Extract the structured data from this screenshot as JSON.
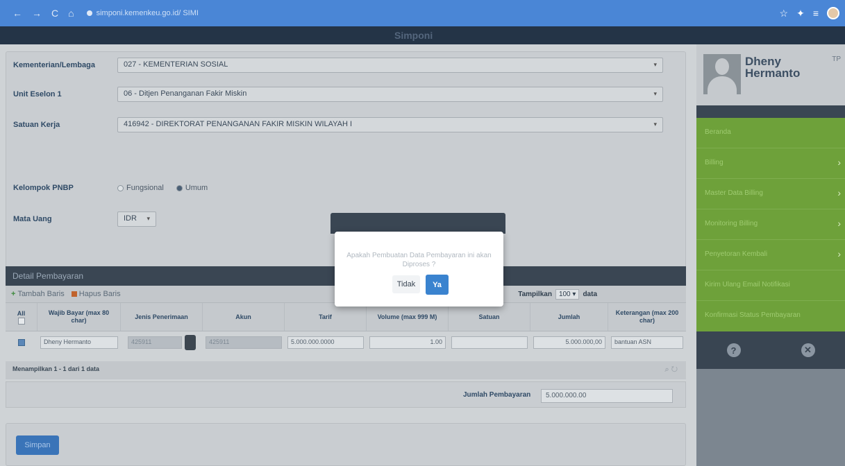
{
  "browser": {
    "url": "simponi.kemenkeu.go.id/ SIMI",
    "nav_back": "←",
    "nav_forward": "→",
    "nav_reload": "C",
    "nav_home": "⌂"
  },
  "app": {
    "logo": "Simponi"
  },
  "form": {
    "kementerian_label": "Kementerian/Lembaga",
    "kementerian_value": "027 - KEMENTERIAN SOSIAL",
    "eselon_label": "Unit Eselon 1",
    "eselon_value": "06 - Ditjen Penanganan Fakir Miskin",
    "satker_label": "Satuan Kerja",
    "satker_value": "416942 - DIREKTORAT PENANGANAN FAKIR MISKIN WILAYAH I",
    "pnbp_label": "Kelompok PNBP",
    "pnbp_options": [
      "Fungsional",
      "Umum"
    ],
    "mata_uang_label": "Mata Uang",
    "mata_uang_value": "IDR"
  },
  "detail": {
    "title": "Detail Pembayaran",
    "add_label": "Tambah Baris",
    "delete_label": "Hapus Baris",
    "show_label": "Tampilkan",
    "show_value": "100",
    "show_suffix": "data",
    "columns": [
      "All",
      "Wajib Bayar (max 80 char)",
      "Jenis Penerimaan",
      "Akun",
      "Tarif",
      "Volume (max 999 M)",
      "Satuan",
      "Jumlah",
      "Keterangan (max 200 char)"
    ],
    "row": {
      "wajib_bayar": "Dheny Hermanto",
      "jenis": "425911",
      "akun": "425911",
      "tarif": "5.000.000.0000",
      "volume": "1.00",
      "satuan": "",
      "jumlah": "5.000.000,00",
      "keterangan": "bantuan ASN"
    },
    "pager_text": "Menampilkan 1 - 1 dari 1 data",
    "total_label": "Jumlah Pembayaran",
    "total_value": "5.000.000.00"
  },
  "save_label": "Simpan",
  "sidebar": {
    "user_name": "Dheny Hermanto",
    "tp": "TP",
    "menu": [
      {
        "label": "Beranda",
        "has_chevron": false
      },
      {
        "label": "Billing",
        "has_chevron": true
      },
      {
        "label": "Master Data Billing",
        "has_chevron": true
      },
      {
        "label": "Monitoring Billing",
        "has_chevron": true
      },
      {
        "label": "Penyetoran Kembali",
        "has_chevron": true
      },
      {
        "label": "Kirim Ulang Email Notifikasi",
        "has_chevron": false
      },
      {
        "label": "Konfirmasi Status Pembayaran",
        "has_chevron": false
      }
    ],
    "help_icon": "?",
    "close_icon": "✕"
  },
  "modal": {
    "message": "Apakah Pembuatan Data Pembayaran ini akan Diproses ?",
    "cancel_label": "Tidak",
    "confirm_label": "Ya"
  }
}
